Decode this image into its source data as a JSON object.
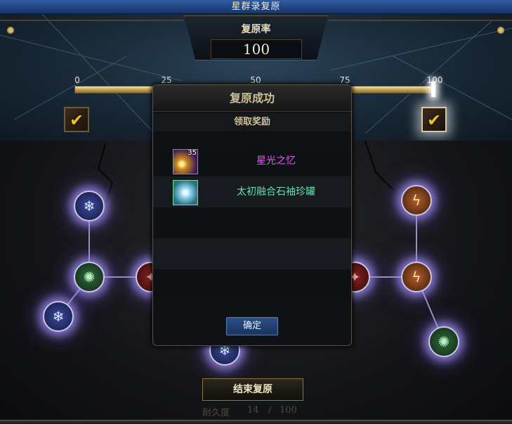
{
  "window": {
    "title": "星群录复原"
  },
  "restore_rate": {
    "label": "复原率",
    "value": "100",
    "progress_percent": 100
  },
  "progress_ticks": [
    "0",
    "25",
    "50",
    "75",
    "100"
  ],
  "milestone_chests": [
    {
      "threshold": "25",
      "icon": "check-chest-icon",
      "claimed": true
    },
    {
      "threshold": "100",
      "icon": "check-chest-icon",
      "claimed": true
    }
  ],
  "modal": {
    "title": "复原成功",
    "subtitle": "领取奖励",
    "rewards": [
      {
        "name": "星光之忆",
        "badge": "35",
        "icon": "starlight-item-icon",
        "color": "#e05ef0"
      },
      {
        "name": "太初融合石袖珍罐",
        "badge": "",
        "icon": "crystal-jar-icon",
        "color": "#5fe0b0"
      }
    ],
    "confirm_label": "确定"
  },
  "footer": {
    "end_button": "结束复原",
    "durability_label": "耐久度",
    "durability_current": "14",
    "durability_sep": "/",
    "durability_max": "100"
  },
  "colors": {
    "accent_gold": "#c8a55a",
    "title_bar": "#2f5c9e",
    "rare_purple": "#e05ef0",
    "rare_green": "#5fe0b0"
  }
}
